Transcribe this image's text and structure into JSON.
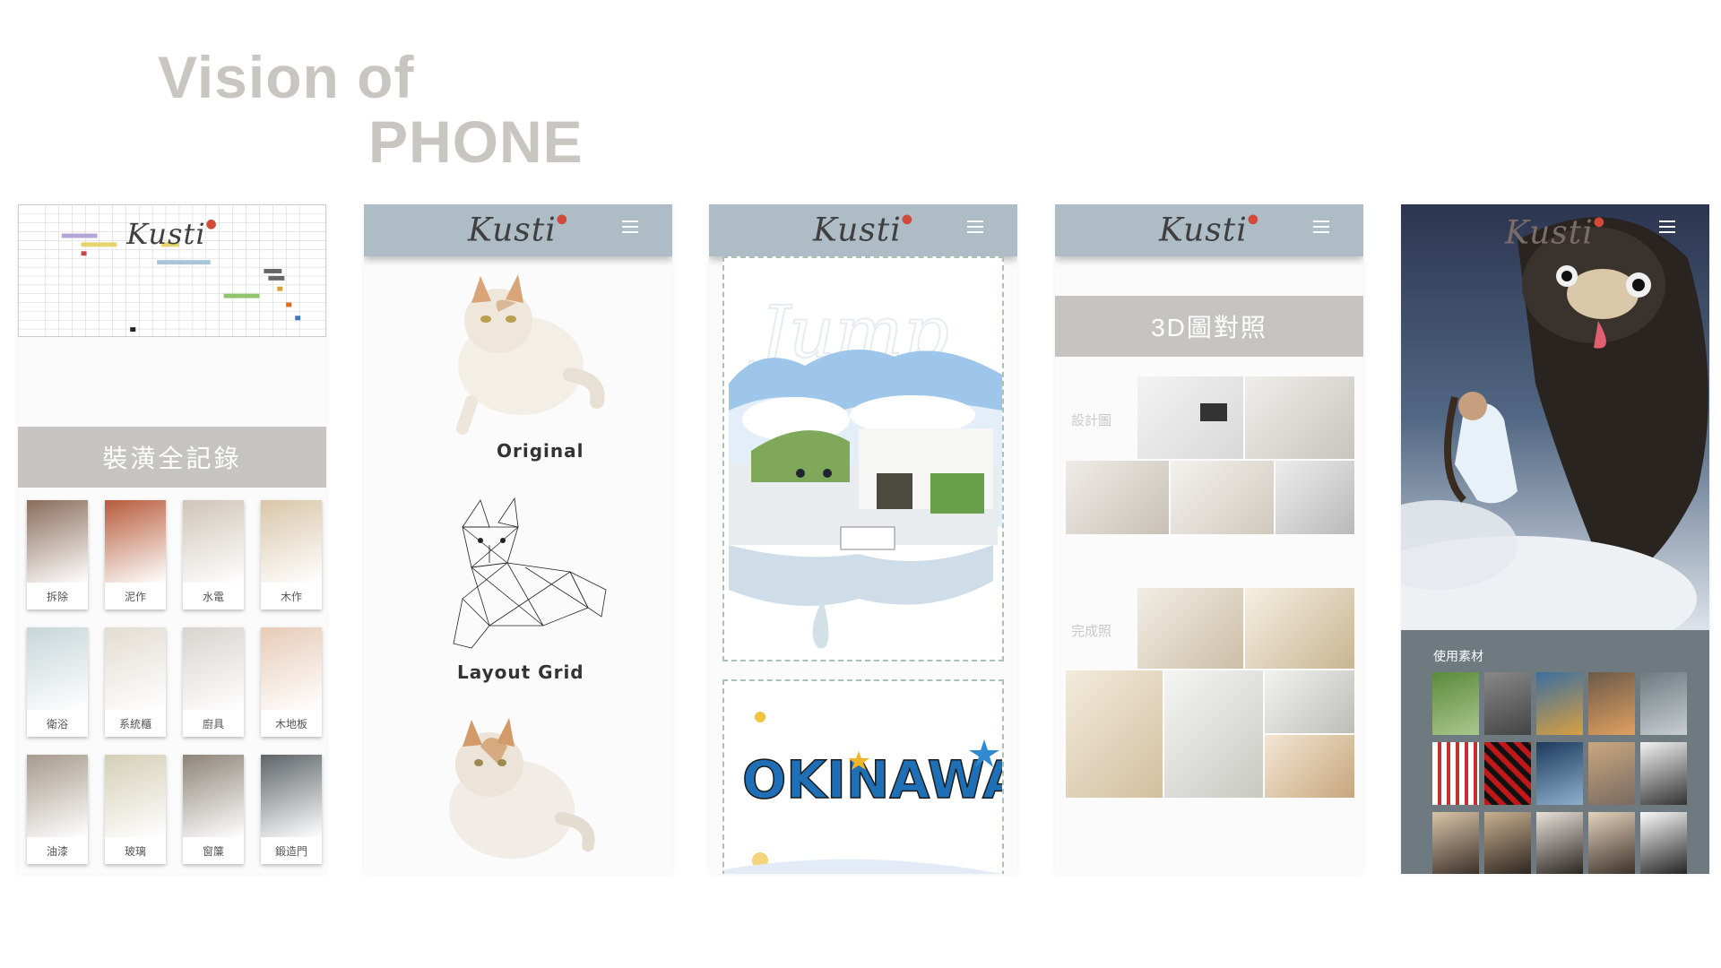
{
  "title": {
    "line1": "Vision of",
    "line2": "PHONE"
  },
  "brand": {
    "logo": "Kusti"
  },
  "phone1": {
    "banner": "裝潢全記錄",
    "tiles": [
      {
        "label": "拆除",
        "color": "#8a6c5a"
      },
      {
        "label": "泥作",
        "color": "#b75b3a"
      },
      {
        "label": "水電",
        "color": "#cfc5b8"
      },
      {
        "label": "木作",
        "color": "#d9c6a8"
      },
      {
        "label": "衛浴",
        "color": "#c7d6d8"
      },
      {
        "label": "系統櫃",
        "color": "#e2ddd2"
      },
      {
        "label": "廚具",
        "color": "#d8d4cf"
      },
      {
        "label": "木地板",
        "color": "#e7cbb6"
      },
      {
        "label": "油漆",
        "color": "#a69a8c"
      },
      {
        "label": "玻璃",
        "color": "#d4cfb6"
      },
      {
        "label": "窗簾",
        "color": "#8d8478"
      },
      {
        "label": "鍛造門",
        "color": "#5d6468"
      }
    ]
  },
  "phone2": {
    "captions": [
      "Original",
      "Layout Grid"
    ]
  },
  "phone3": {
    "card1_text": "Jump",
    "card2_text": "OKINAWA"
  },
  "phone4": {
    "banner": "3D圖對照",
    "label_design": "設計圖",
    "label_done": "完成照"
  },
  "phone5": {
    "assets_label": "使用素材"
  },
  "colors": {
    "bar": "#aebcc6",
    "banner_gray": "#c6c4c0",
    "title_gray": "#c9c6c1"
  }
}
